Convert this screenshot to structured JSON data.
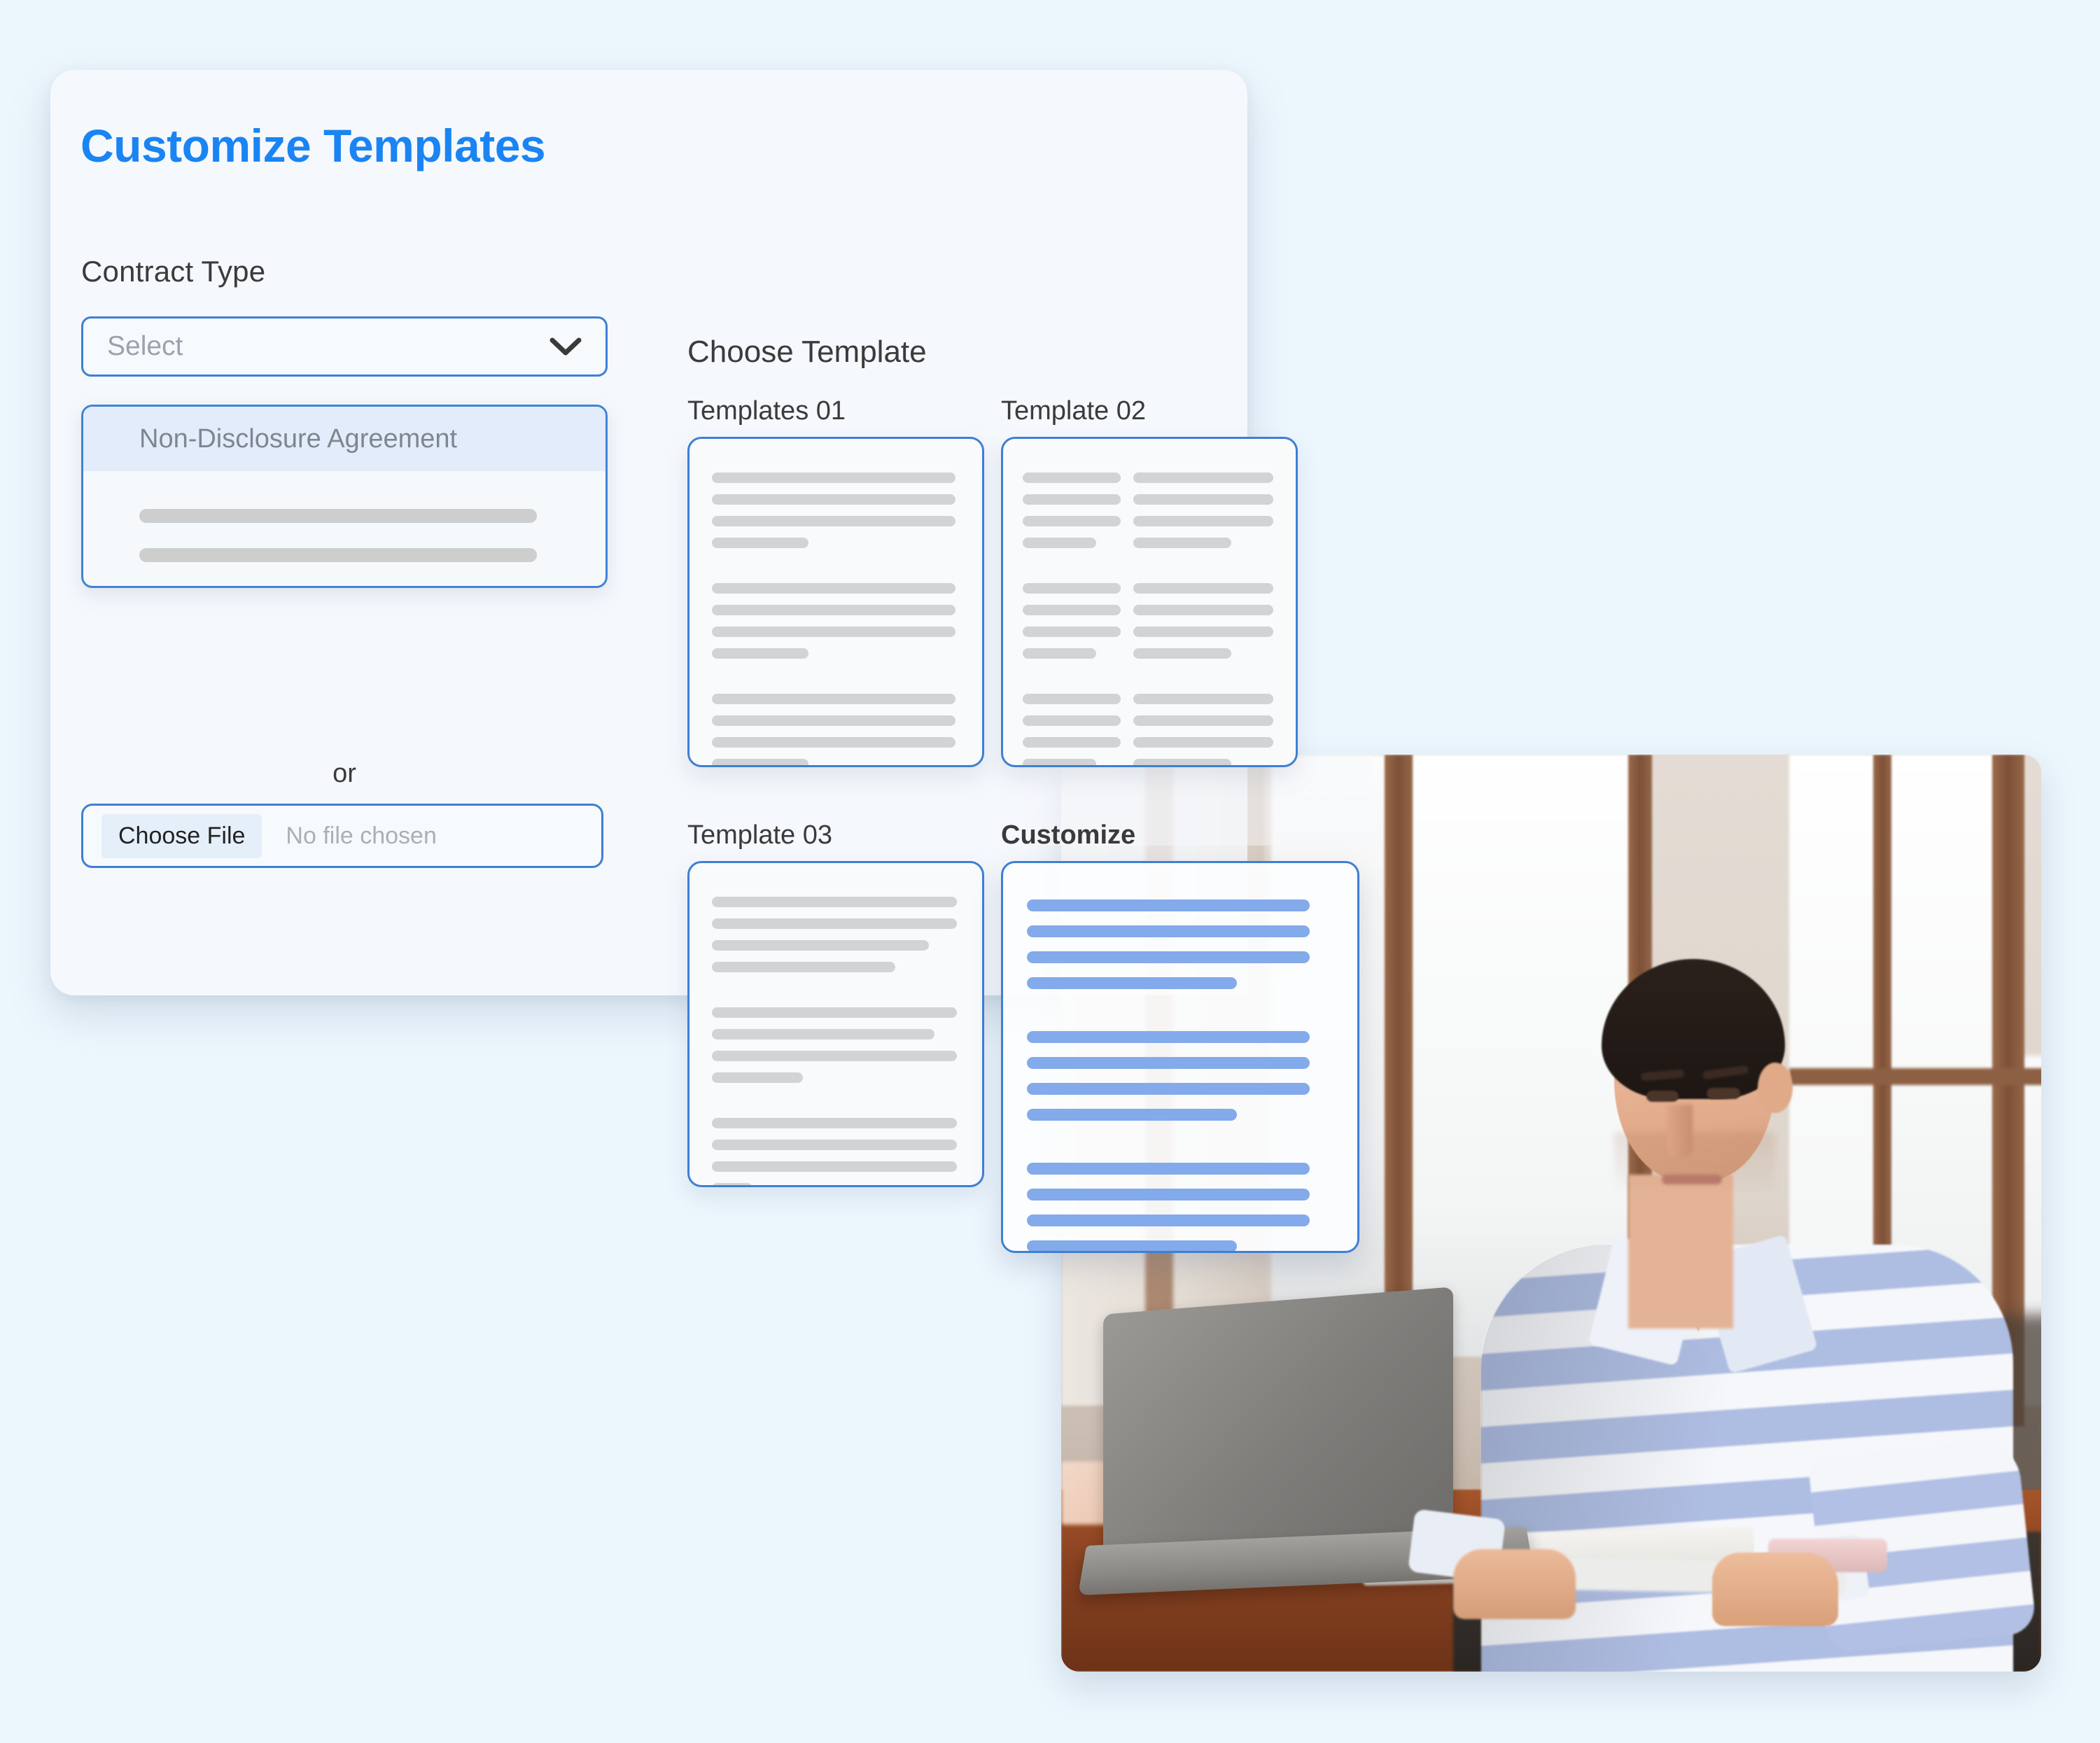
{
  "page": {
    "background_color": "#ecf6fd",
    "accent_color": "#1a84f3",
    "border_color": "#3f7fd4",
    "placeholder_line_color": "#d2d3d4",
    "customize_line_color": "#83aaeb"
  },
  "panel": {
    "title": "Customize Templates"
  },
  "contract_type": {
    "label": "Contract Type",
    "select_value": "Select",
    "chevron_icon": "chevron-down-icon",
    "dropdown": {
      "options": [
        "Non-Disclosure Agreement"
      ],
      "placeholder_rows": 3
    }
  },
  "separator": {
    "text": "or"
  },
  "file_upload": {
    "button_label": "Choose File",
    "status_text": "No file chosen"
  },
  "choose_template": {
    "heading": "Choose Template",
    "cards": [
      {
        "label": "Templates 01",
        "style": "single-column",
        "line_color": "#d2d3d4"
      },
      {
        "label": "Template 02",
        "style": "two-column",
        "line_color": "#d2d3d4"
      },
      {
        "label": "Template 03",
        "style": "single-column",
        "line_color": "#d2d3d4"
      },
      {
        "label": "Customize",
        "style": "single-column",
        "line_color": "#83aaeb"
      }
    ]
  },
  "photo": {
    "alt": "man-working-on-laptop-in-office"
  }
}
